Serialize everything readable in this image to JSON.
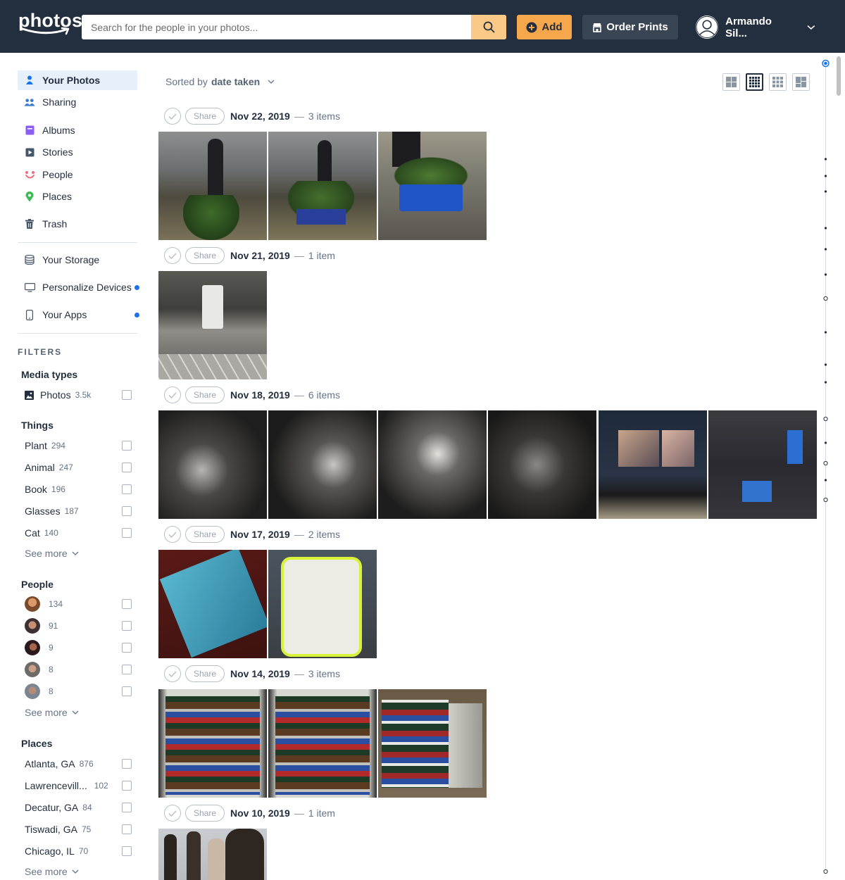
{
  "header": {
    "logo_text": "photos",
    "search_placeholder": "Search for the people in your photos...",
    "add_label": "Add",
    "order_prints_label": "Order Prints",
    "account_name": "Armando Sil..."
  },
  "sidebar": {
    "nav": [
      {
        "label": "Your Photos",
        "icon": "person-icon",
        "active": true
      },
      {
        "label": "Sharing",
        "icon": "people-group-icon"
      },
      {
        "label": "Albums",
        "icon": "album-icon"
      },
      {
        "label": "Stories",
        "icon": "play-icon"
      },
      {
        "label": "People",
        "icon": "smile-face-icon"
      },
      {
        "label": "Places",
        "icon": "map-pin-icon"
      },
      {
        "label": "Trash",
        "icon": "trash-icon"
      },
      {
        "label": "Your Storage",
        "icon": "storage-icon"
      },
      {
        "label": "Personalize Devices",
        "icon": "monitor-icon",
        "notify": true
      },
      {
        "label": "Your Apps",
        "icon": "phone-icon",
        "notify": true
      }
    ],
    "filters_title": "FILTERS",
    "media_types": {
      "title": "Media types",
      "items": [
        {
          "label": "Photos",
          "count": "3.5k"
        }
      ]
    },
    "things": {
      "title": "Things",
      "items": [
        {
          "label": "Plant",
          "count": "294"
        },
        {
          "label": "Animal",
          "count": "247"
        },
        {
          "label": "Book",
          "count": "196"
        },
        {
          "label": "Glasses",
          "count": "187"
        },
        {
          "label": "Cat",
          "count": "140"
        }
      ]
    },
    "people": {
      "title": "People",
      "items": [
        {
          "count": "134"
        },
        {
          "count": "91"
        },
        {
          "count": "9"
        },
        {
          "count": "8"
        },
        {
          "count": "8"
        }
      ]
    },
    "places": {
      "title": "Places",
      "items": [
        {
          "label": "Atlanta, GA",
          "count": "876"
        },
        {
          "label": "Lawrencevill...",
          "count": "102"
        },
        {
          "label": "Decatur, GA",
          "count": "84"
        },
        {
          "label": "Tiswadi, GA",
          "count": "75"
        },
        {
          "label": "Chicago, IL",
          "count": "70"
        }
      ]
    },
    "see_more": "See more"
  },
  "main": {
    "sort_prefix": "Sorted by",
    "sort_value": "date taken",
    "share_label": "Share",
    "dash": "—",
    "groups": [
      {
        "date": "Nov 22, 2019",
        "count": "3 items"
      },
      {
        "date": "Nov 21, 2019",
        "count": "1 item"
      },
      {
        "date": "Nov 18, 2019",
        "count": "6 items"
      },
      {
        "date": "Nov 17, 2019",
        "count": "2 items"
      },
      {
        "date": "Nov 14, 2019",
        "count": "3 items"
      },
      {
        "date": "Nov 10, 2019",
        "count": "1 item"
      }
    ]
  },
  "colors": {
    "header_bg": "#232f3e",
    "accent_orange": "#f7a74b",
    "search_btn": "#fbc987",
    "active_bg": "#e5f0fb",
    "notify_dot": "#1a73e8"
  }
}
